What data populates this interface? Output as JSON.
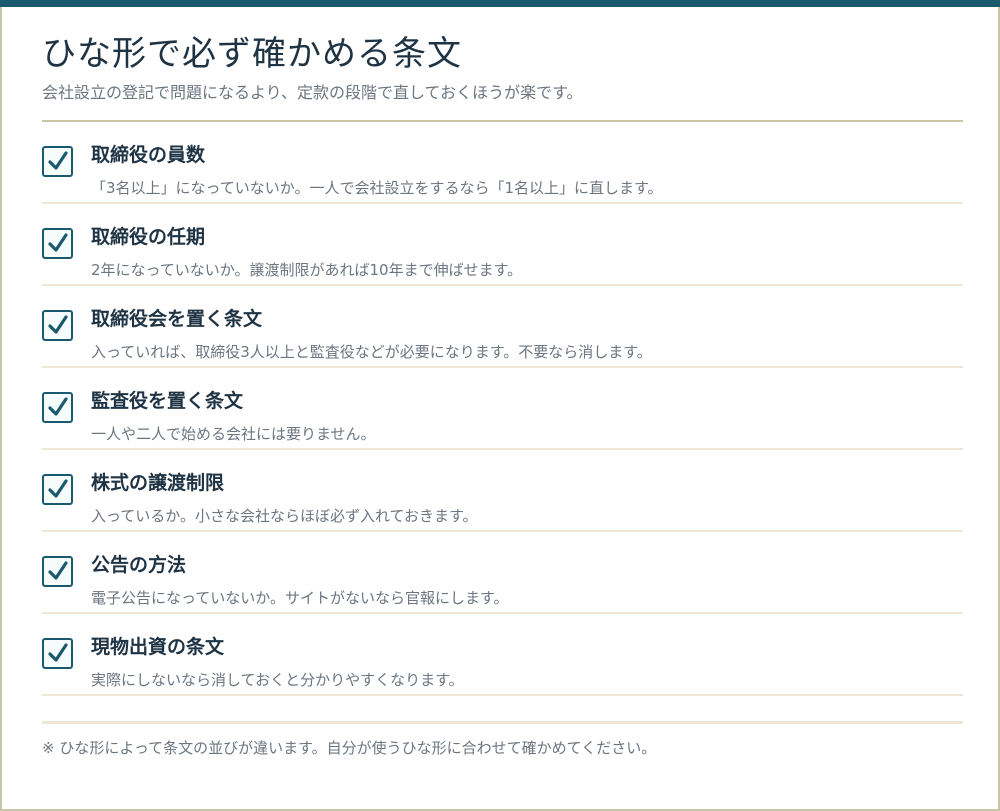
{
  "title": "ひな形で必ず確かめる条文",
  "subtitle": "会社設立の登記で問題になるより、定款の段階で直しておくほうが楽です。",
  "items": [
    {
      "title": "取締役の員数",
      "desc": "「3名以上」になっていないか。一人で会社設立をするなら「1名以上」に直します。",
      "checked": true
    },
    {
      "title": "取締役の任期",
      "desc": "2年になっていないか。譲渡制限があれば10年まで伸ばせます。",
      "checked": true
    },
    {
      "title": "取締役会を置く条文",
      "desc": "入っていれば、取締役3人以上と監査役などが必要になります。不要なら消します。",
      "checked": true
    },
    {
      "title": "監査役を置く条文",
      "desc": "一人や二人で始める会社には要りません。",
      "checked": true
    },
    {
      "title": "株式の譲渡制限",
      "desc": "入っているか。小さな会社ならほぼ必ず入れておきます。",
      "checked": true
    },
    {
      "title": "公告の方法",
      "desc": "電子公告になっていないか。サイトがないなら官報にします。",
      "checked": true
    },
    {
      "title": "現物出資の条文",
      "desc": "実際にしないなら消しておくと分かりやすくなります。",
      "checked": true
    }
  ],
  "note": "※ ひな形によって条文の並びが違います。自分が使うひな形に合わせて確かめてください。",
  "colors": {
    "accent": "#1b5a6e",
    "text": "#1e3344",
    "muted": "#6c7580",
    "rule": "#c9c4a6",
    "divider": "#efe7d6"
  },
  "icons": {
    "checkbox": "checkbox-checked-icon",
    "check": "checkmark-icon"
  }
}
